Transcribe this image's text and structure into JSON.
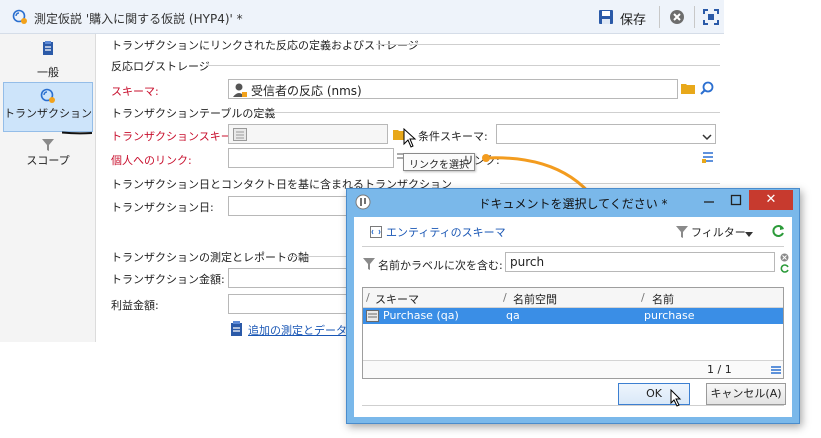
{
  "window": {
    "title": "測定仮説 '購入に関する仮説 (HYP4)' *",
    "save_label": "保存"
  },
  "sidebar": {
    "items": [
      {
        "label": "一般"
      },
      {
        "label": "トランザクション"
      },
      {
        "label": "スコープ"
      }
    ]
  },
  "form": {
    "main_section": "トランザクションにリンクされた反応の定義およびストレージ",
    "response_log_section": "反応ログストレージ",
    "schema_label": "スキーマ:",
    "schema_value": "受信者の反応 (nms)",
    "transaction_table_section": "トランザクションテーブルの定義",
    "transaction_schema_label": "トランザクションスキーマ:",
    "condition_schema_label": "条件スキーマ:",
    "individual_link_label": "個人へのリンク:",
    "link_label_partial": "リンク:",
    "tooltip": "リンクを選択",
    "date_section": "トランザクション日とコンタクト日を基に含まれるトランザクション",
    "transaction_date_label": "トランザクション日:",
    "axis_section": "トランザクションの測定とレポートの軸",
    "transaction_amount_label": "トランザクション金額:",
    "profit_amount_label": "利益金額:",
    "additional_link": "追加の測定とデータ"
  },
  "dialog": {
    "title": "ドキュメントを選択してください *",
    "entity_schema_label": "エンティティのスキーマ",
    "filter_label": "フィルター",
    "search_label": "名前かラベルに次を含む:",
    "search_value": "purch",
    "columns": [
      "スキーマ",
      "名前空間",
      "名前"
    ],
    "rows": [
      {
        "schema": "Purchase (qa)",
        "namespace": "qa",
        "name": "purchase"
      }
    ],
    "pagination": "1 / 1",
    "ok_label": "OK",
    "cancel_label": "キャンセル(A)"
  },
  "colors": {
    "accent": "#1a57b5",
    "required": "#c8102e",
    "dialog_frame": "#7ab8ea",
    "selection": "#3a8ee6",
    "arrow": "#f39c1f"
  }
}
